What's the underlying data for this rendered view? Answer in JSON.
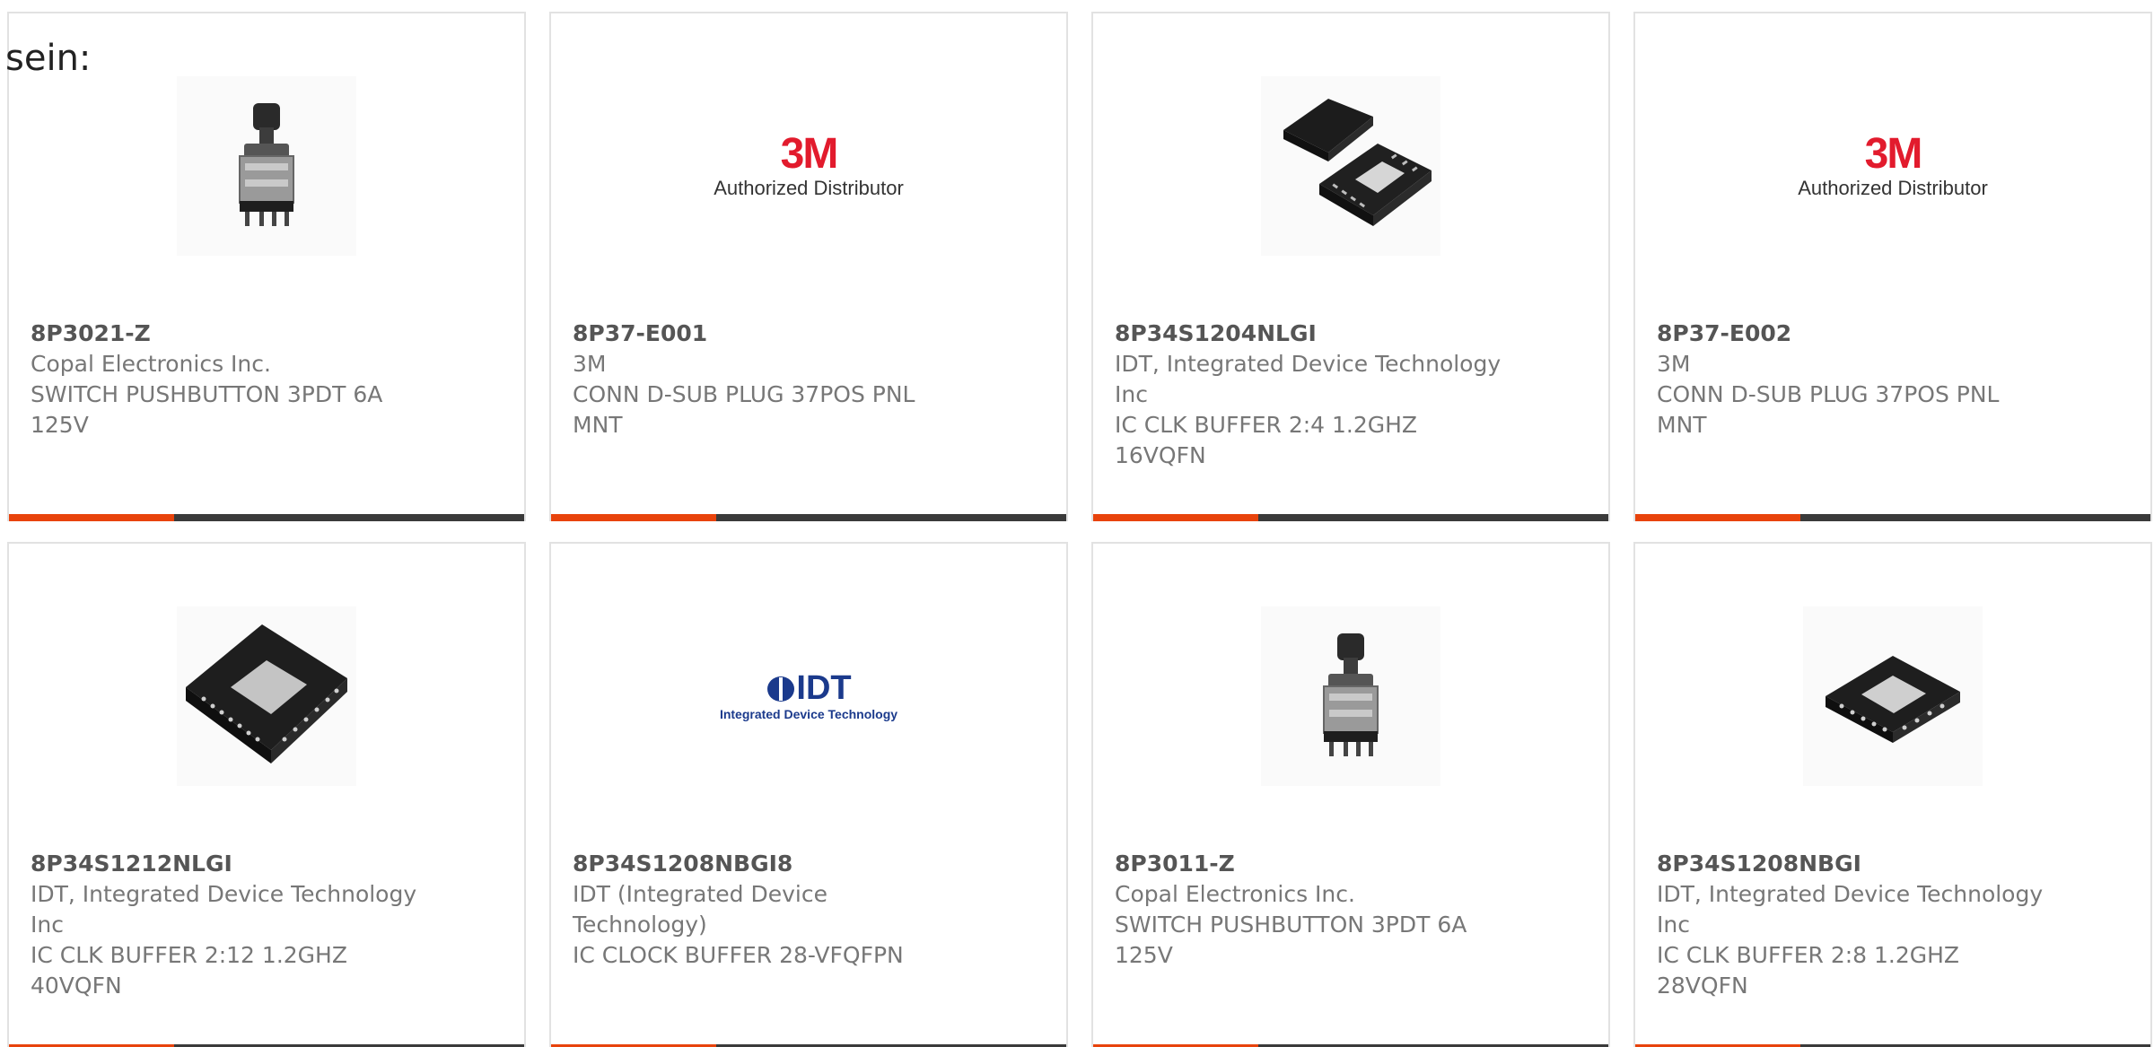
{
  "intro_text": "sein:",
  "colors": {
    "accent": "#e8430c",
    "bar_dark": "#3a3a3a",
    "brand_3m": "#e21b2d",
    "brand_idt": "#1b3a8c"
  },
  "products": [
    {
      "part_number": "8P3021-Z",
      "manufacturer": "Copal Electronics Inc.",
      "description": "SWITCH PUSHBUTTON 3PDT 6A 125V",
      "image": "pushbutton-switch"
    },
    {
      "part_number": "8P37-E001",
      "manufacturer": "3M",
      "description": "CONN D-SUB PLUG 37POS PNL MNT",
      "image": "3m-logo",
      "logo_mark": "3M",
      "logo_sub": "Authorized Distributor"
    },
    {
      "part_number": "8P34S1204NLGI",
      "manufacturer": "IDT, Integrated Device Technology Inc",
      "description": "IC CLK BUFFER 2:4 1.2GHZ 16VQFN",
      "image": "qfn-chip-pair"
    },
    {
      "part_number": "8P37-E002",
      "manufacturer": "3M",
      "description": "CONN D-SUB PLUG 37POS PNL MNT",
      "image": "3m-logo",
      "logo_mark": "3M",
      "logo_sub": "Authorized Distributor"
    },
    {
      "part_number": "8P34S1212NLGI",
      "manufacturer": "IDT, Integrated Device Technology Inc",
      "description": "IC CLK BUFFER 2:12 1.2GHZ 40VQFN",
      "image": "qfn-chip-large"
    },
    {
      "part_number": "8P34S1208NBGI8",
      "manufacturer": "IDT (Integrated Device Technology)",
      "description": "IC CLOCK BUFFER 28-VFQFPN",
      "image": "idt-logo",
      "logo_mark": "IDT",
      "logo_sub": "Integrated Device Technology"
    },
    {
      "part_number": "8P3011-Z",
      "manufacturer": "Copal Electronics Inc.",
      "description": "SWITCH PUSHBUTTON 3PDT 6A 125V",
      "image": "pushbutton-switch"
    },
    {
      "part_number": "8P34S1208NBGI",
      "manufacturer": "IDT, Integrated Device Technology Inc",
      "description": "IC CLK BUFFER 2:8 1.2GHZ 28VQFN",
      "image": "qfn-chip-flat"
    }
  ]
}
